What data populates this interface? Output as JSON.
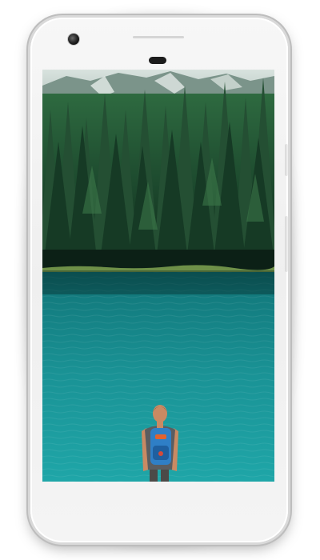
{
  "device": {
    "type": "smartphone",
    "body_color": "#f4f4f4",
    "frame_color": "#bdbdbd"
  },
  "screen": {
    "content": "photo",
    "palette": {
      "sky": "#c9d7d3",
      "mountain": "#6f8a80",
      "forest_dark": "#0f2a1c",
      "forest_mid": "#1d4a30",
      "forest_light": "#3a7548",
      "shore": "#6f8f4a",
      "water_top": "#0f6f70",
      "water_mid": "#168f92",
      "water_bottom": "#1ea3a6",
      "backpack": "#2f7fc6",
      "shirt": "#5b5d60",
      "skin": "#c98a63",
      "hair": "#2a2420"
    }
  }
}
